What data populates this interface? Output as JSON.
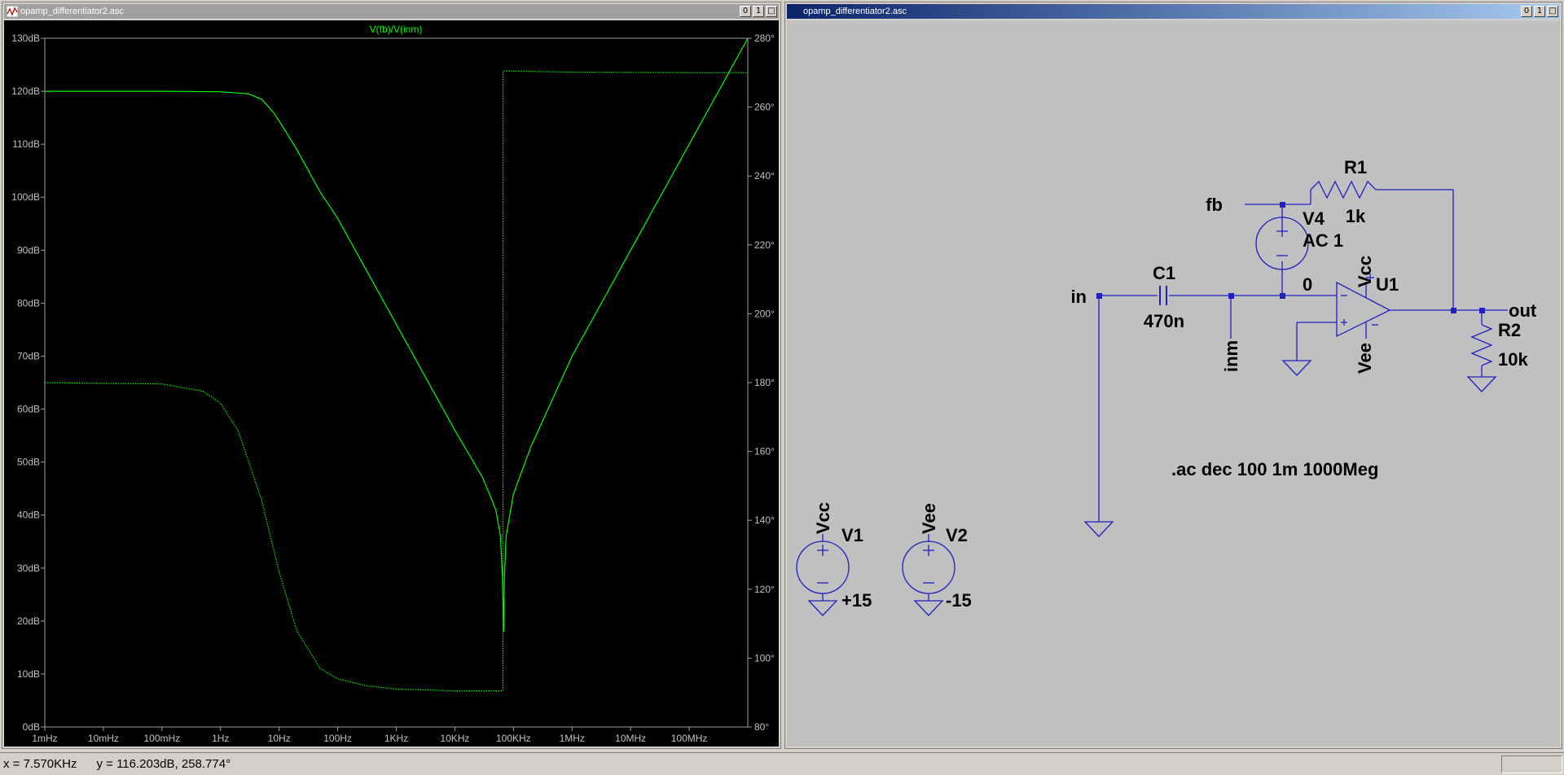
{
  "plot_window": {
    "title": "opamp_differentiator2.asc",
    "controls": [
      "0",
      "1",
      "□"
    ]
  },
  "schematic_window": {
    "title": "opamp_differentiator2.asc",
    "controls": [
      "0",
      "1",
      "□"
    ]
  },
  "chart_data": {
    "type": "line",
    "title": "V(fb)/V(inm)",
    "x_scale": "log",
    "x_ticks": [
      "1mHz",
      "10mHz",
      "100mHz",
      "1Hz",
      "10Hz",
      "100Hz",
      "1KHz",
      "10KHz",
      "100KHz",
      "1MHz",
      "10MHz",
      "100MHz"
    ],
    "xlim_hz": [
      0.001,
      1000000000
    ],
    "y_left_ticks": [
      "0dB",
      "10dB",
      "20dB",
      "30dB",
      "40dB",
      "50dB",
      "60dB",
      "70dB",
      "80dB",
      "90dB",
      "100dB",
      "110dB",
      "120dB",
      "130dB"
    ],
    "ylim_left_db": [
      0,
      130
    ],
    "y_right_ticks": [
      "80°",
      "100°",
      "120°",
      "140°",
      "160°",
      "180°",
      "200°",
      "220°",
      "240°",
      "260°",
      "280°"
    ],
    "ylim_right_deg": [
      80,
      280
    ],
    "grid": false,
    "color": "#00ff00",
    "series": [
      {
        "axis": "left",
        "style": "solid",
        "x": [
          0.001,
          0.1,
          1,
          3,
          5,
          8,
          12,
          20,
          50,
          100,
          1000,
          10000,
          30000,
          50000,
          60000,
          65000,
          68000,
          70000,
          75000,
          100000,
          200000,
          1000000,
          10000000,
          100000000,
          1000000000
        ],
        "y": [
          120,
          120,
          119.9,
          119.5,
          118.5,
          116,
          113,
          109,
          101,
          96,
          76,
          56,
          47,
          41,
          36,
          28,
          18,
          28,
          36,
          44,
          53,
          70,
          90,
          110,
          130
        ]
      },
      {
        "axis": "right",
        "style": "dotted",
        "x": [
          0.001,
          0.1,
          0.5,
          1,
          2,
          5,
          10,
          20,
          50,
          100,
          300,
          1000,
          10000,
          66000,
          66500,
          70000,
          1000000,
          10000000,
          100000000,
          1000000000
        ],
        "y": [
          180,
          179.6,
          177.5,
          174,
          166,
          146,
          125,
          108,
          97,
          94,
          92,
          91,
          90.5,
          90.5,
          270.5,
          270.5,
          270.2,
          270.1,
          270,
          270
        ]
      }
    ]
  },
  "schematic": {
    "labels": {
      "fb": "fb",
      "v4_name": "V4",
      "v4_value": "AC 1",
      "zero": "0",
      "r1_name": "R1",
      "r1_value": "1k",
      "c1_name": "C1",
      "c1_value": "470n",
      "in": "in",
      "inm": "inm",
      "vcc_u1": "Vcc",
      "vee_u1": "Vee",
      "u1_name": "U1",
      "out": "out",
      "r2_name": "R2",
      "r2_value": "10k",
      "directive": ".ac dec 100 1m 1000Meg",
      "vcc_v1": "Vcc",
      "v1_name": "V1",
      "v1_value": "+15",
      "vee_v2": "Vee",
      "v2_name": "V2",
      "v2_value": "-15"
    }
  },
  "statusbar": {
    "x": "x = 7.570KHz",
    "y": "y = 116.203dB, 258.774°"
  }
}
